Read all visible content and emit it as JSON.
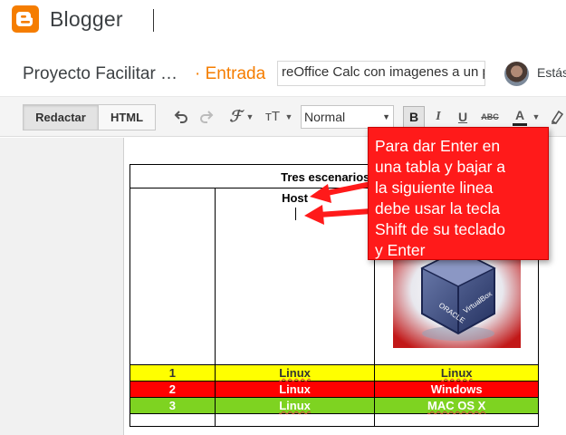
{
  "app": {
    "brand": "Blogger"
  },
  "post": {
    "title_short": "Proyecto Facilitar …",
    "type_label": "· Entrada",
    "title_field_value": "reOffice Calc con imagenes a un pc",
    "status": "Estás"
  },
  "toolbar": {
    "compose_label": "Redactar",
    "html_label": "HTML",
    "undo_icon": "undo-icon",
    "redo_icon": "redo-icon",
    "font_label": "ℱ",
    "size_label": "тT",
    "format_value": "Normal",
    "bold_label": "B",
    "italic_label": "I",
    "underline_label": "U",
    "strike_label": "ABC",
    "textcolor_label": "A"
  },
  "table": {
    "header": "Tres escenarios po",
    "col2_title": "Host",
    "rows": [
      {
        "num": "1",
        "host": "Linux",
        "guest": "Linux",
        "color": "#ffff00"
      },
      {
        "num": "2",
        "host": "Linux",
        "guest": "Windows",
        "color": "#ff0000"
      },
      {
        "num": "3",
        "host": "Linux",
        "guest": "MAC OS X",
        "color": "#7ed321"
      }
    ]
  },
  "image": {
    "left_label": "ORACLE",
    "right_label": "VirtualBox"
  },
  "callout": {
    "lines": [
      "Para dar Enter en",
      "una tabla y bajar a",
      "la siguiente linea",
      "debe usar la tecla",
      "Shift de su teclado",
      "y Enter"
    ]
  },
  "colors": {
    "brand": "#f57d00",
    "callout": "#ff1a1a"
  }
}
